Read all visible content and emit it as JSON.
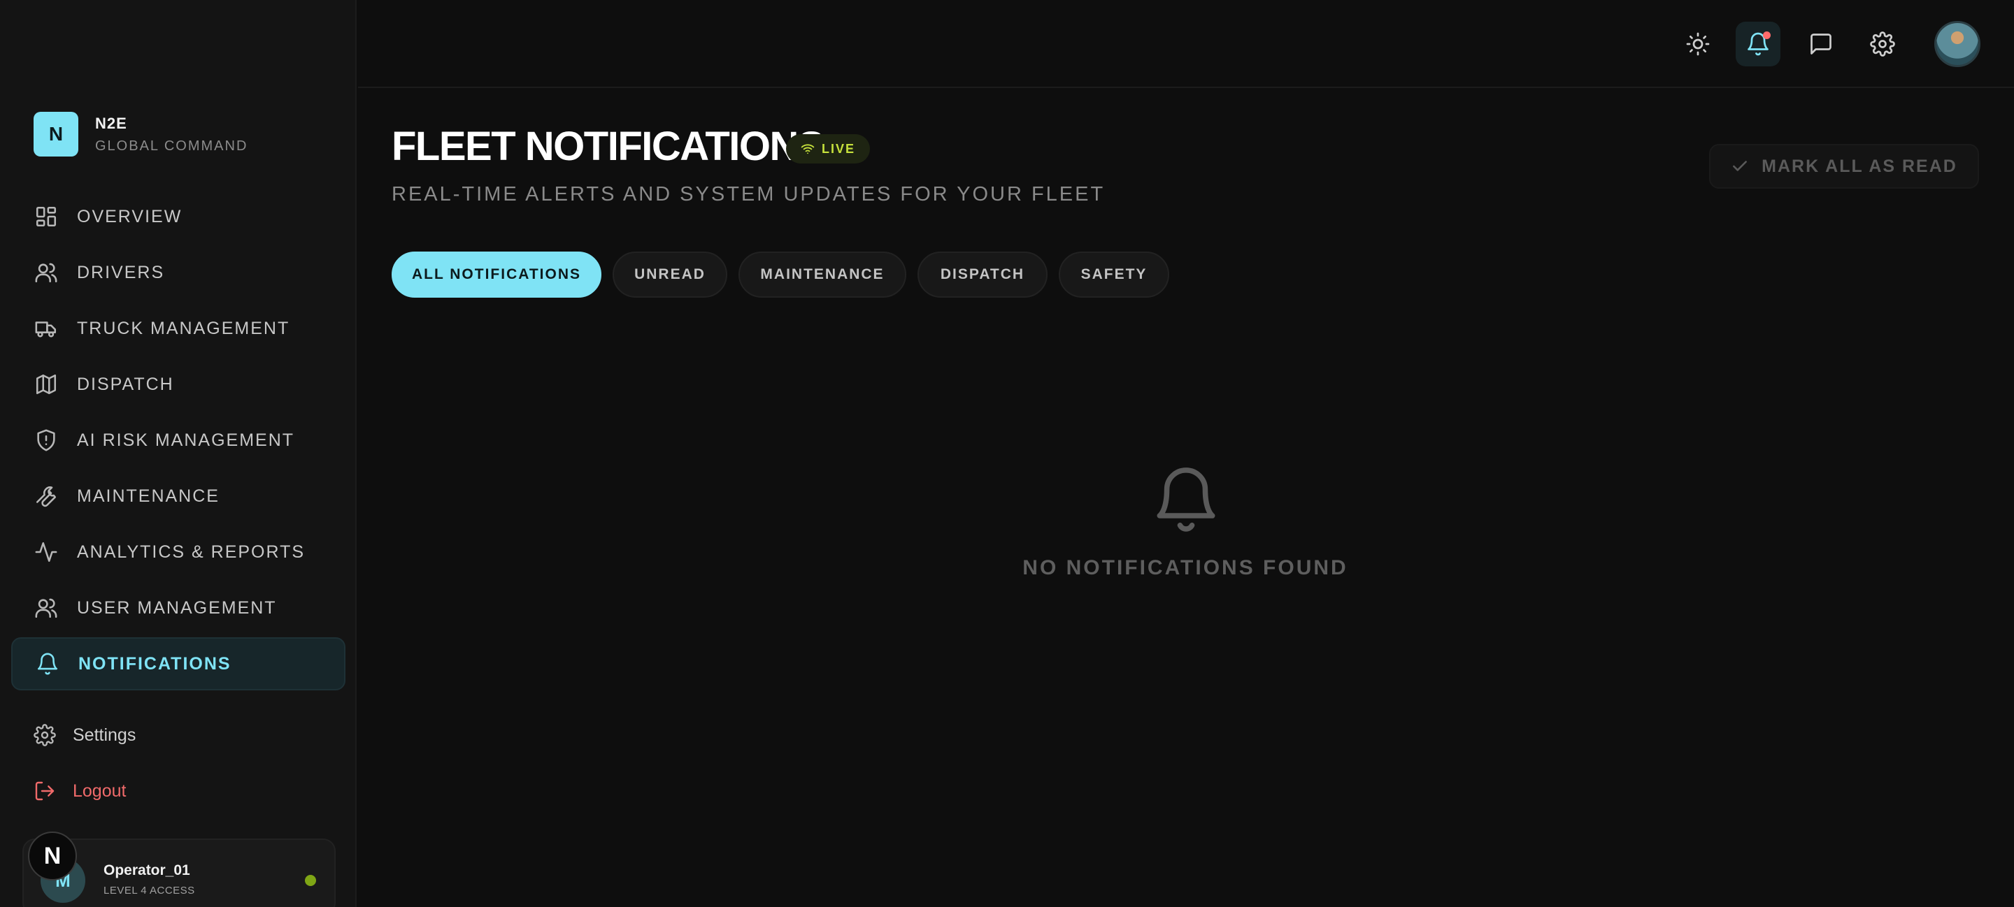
{
  "brand": {
    "logo_letter": "N",
    "name": "N2E",
    "subtitle": "GLOBAL COMMAND"
  },
  "sidebar": {
    "items": [
      {
        "label": "OVERVIEW",
        "icon": "grid-icon"
      },
      {
        "label": "DRIVERS",
        "icon": "users-icon"
      },
      {
        "label": "TRUCK MANAGEMENT",
        "icon": "truck-icon"
      },
      {
        "label": "DISPATCH",
        "icon": "map-icon"
      },
      {
        "label": "AI RISK MANAGEMENT",
        "icon": "shield-alert-icon"
      },
      {
        "label": "MAINTENANCE",
        "icon": "wrench-icon"
      },
      {
        "label": "ANALYTICS & REPORTS",
        "icon": "activity-icon"
      },
      {
        "label": "USER MANAGEMENT",
        "icon": "users-icon"
      },
      {
        "label": "NOTIFICATIONS",
        "icon": "bell-icon",
        "active": true
      }
    ],
    "settings_label": "Settings",
    "logout_label": "Logout"
  },
  "user": {
    "avatar_letter": "M",
    "name": "Operator_01",
    "role": "LEVEL 4 ACCESS",
    "status_color": "#7fa615"
  },
  "dev_badge": {
    "letter": "N"
  },
  "topbar": {
    "icons": [
      "sun-icon",
      "bell-icon",
      "message-icon",
      "gear-icon",
      "profile-avatar"
    ],
    "has_unread": true
  },
  "page": {
    "title": "FLEET NOTIFICATIONS",
    "live_label": "LIVE",
    "subtitle": "REAL-TIME ALERTS AND SYSTEM UPDATES FOR YOUR FLEET",
    "mark_all_label": "MARK ALL AS READ"
  },
  "filters": [
    {
      "label": "ALL NOTIFICATIONS",
      "active": true
    },
    {
      "label": "UNREAD"
    },
    {
      "label": "MAINTENANCE"
    },
    {
      "label": "DISPATCH"
    },
    {
      "label": "SAFETY"
    }
  ],
  "empty_state": {
    "message": "NO NOTIFICATIONS FOUND",
    "icon": "bell-icon"
  },
  "colors": {
    "accent": "#7fe3f5",
    "live": "#c6e13c",
    "danger": "#f06a6a",
    "background": "#0e0e0e"
  }
}
